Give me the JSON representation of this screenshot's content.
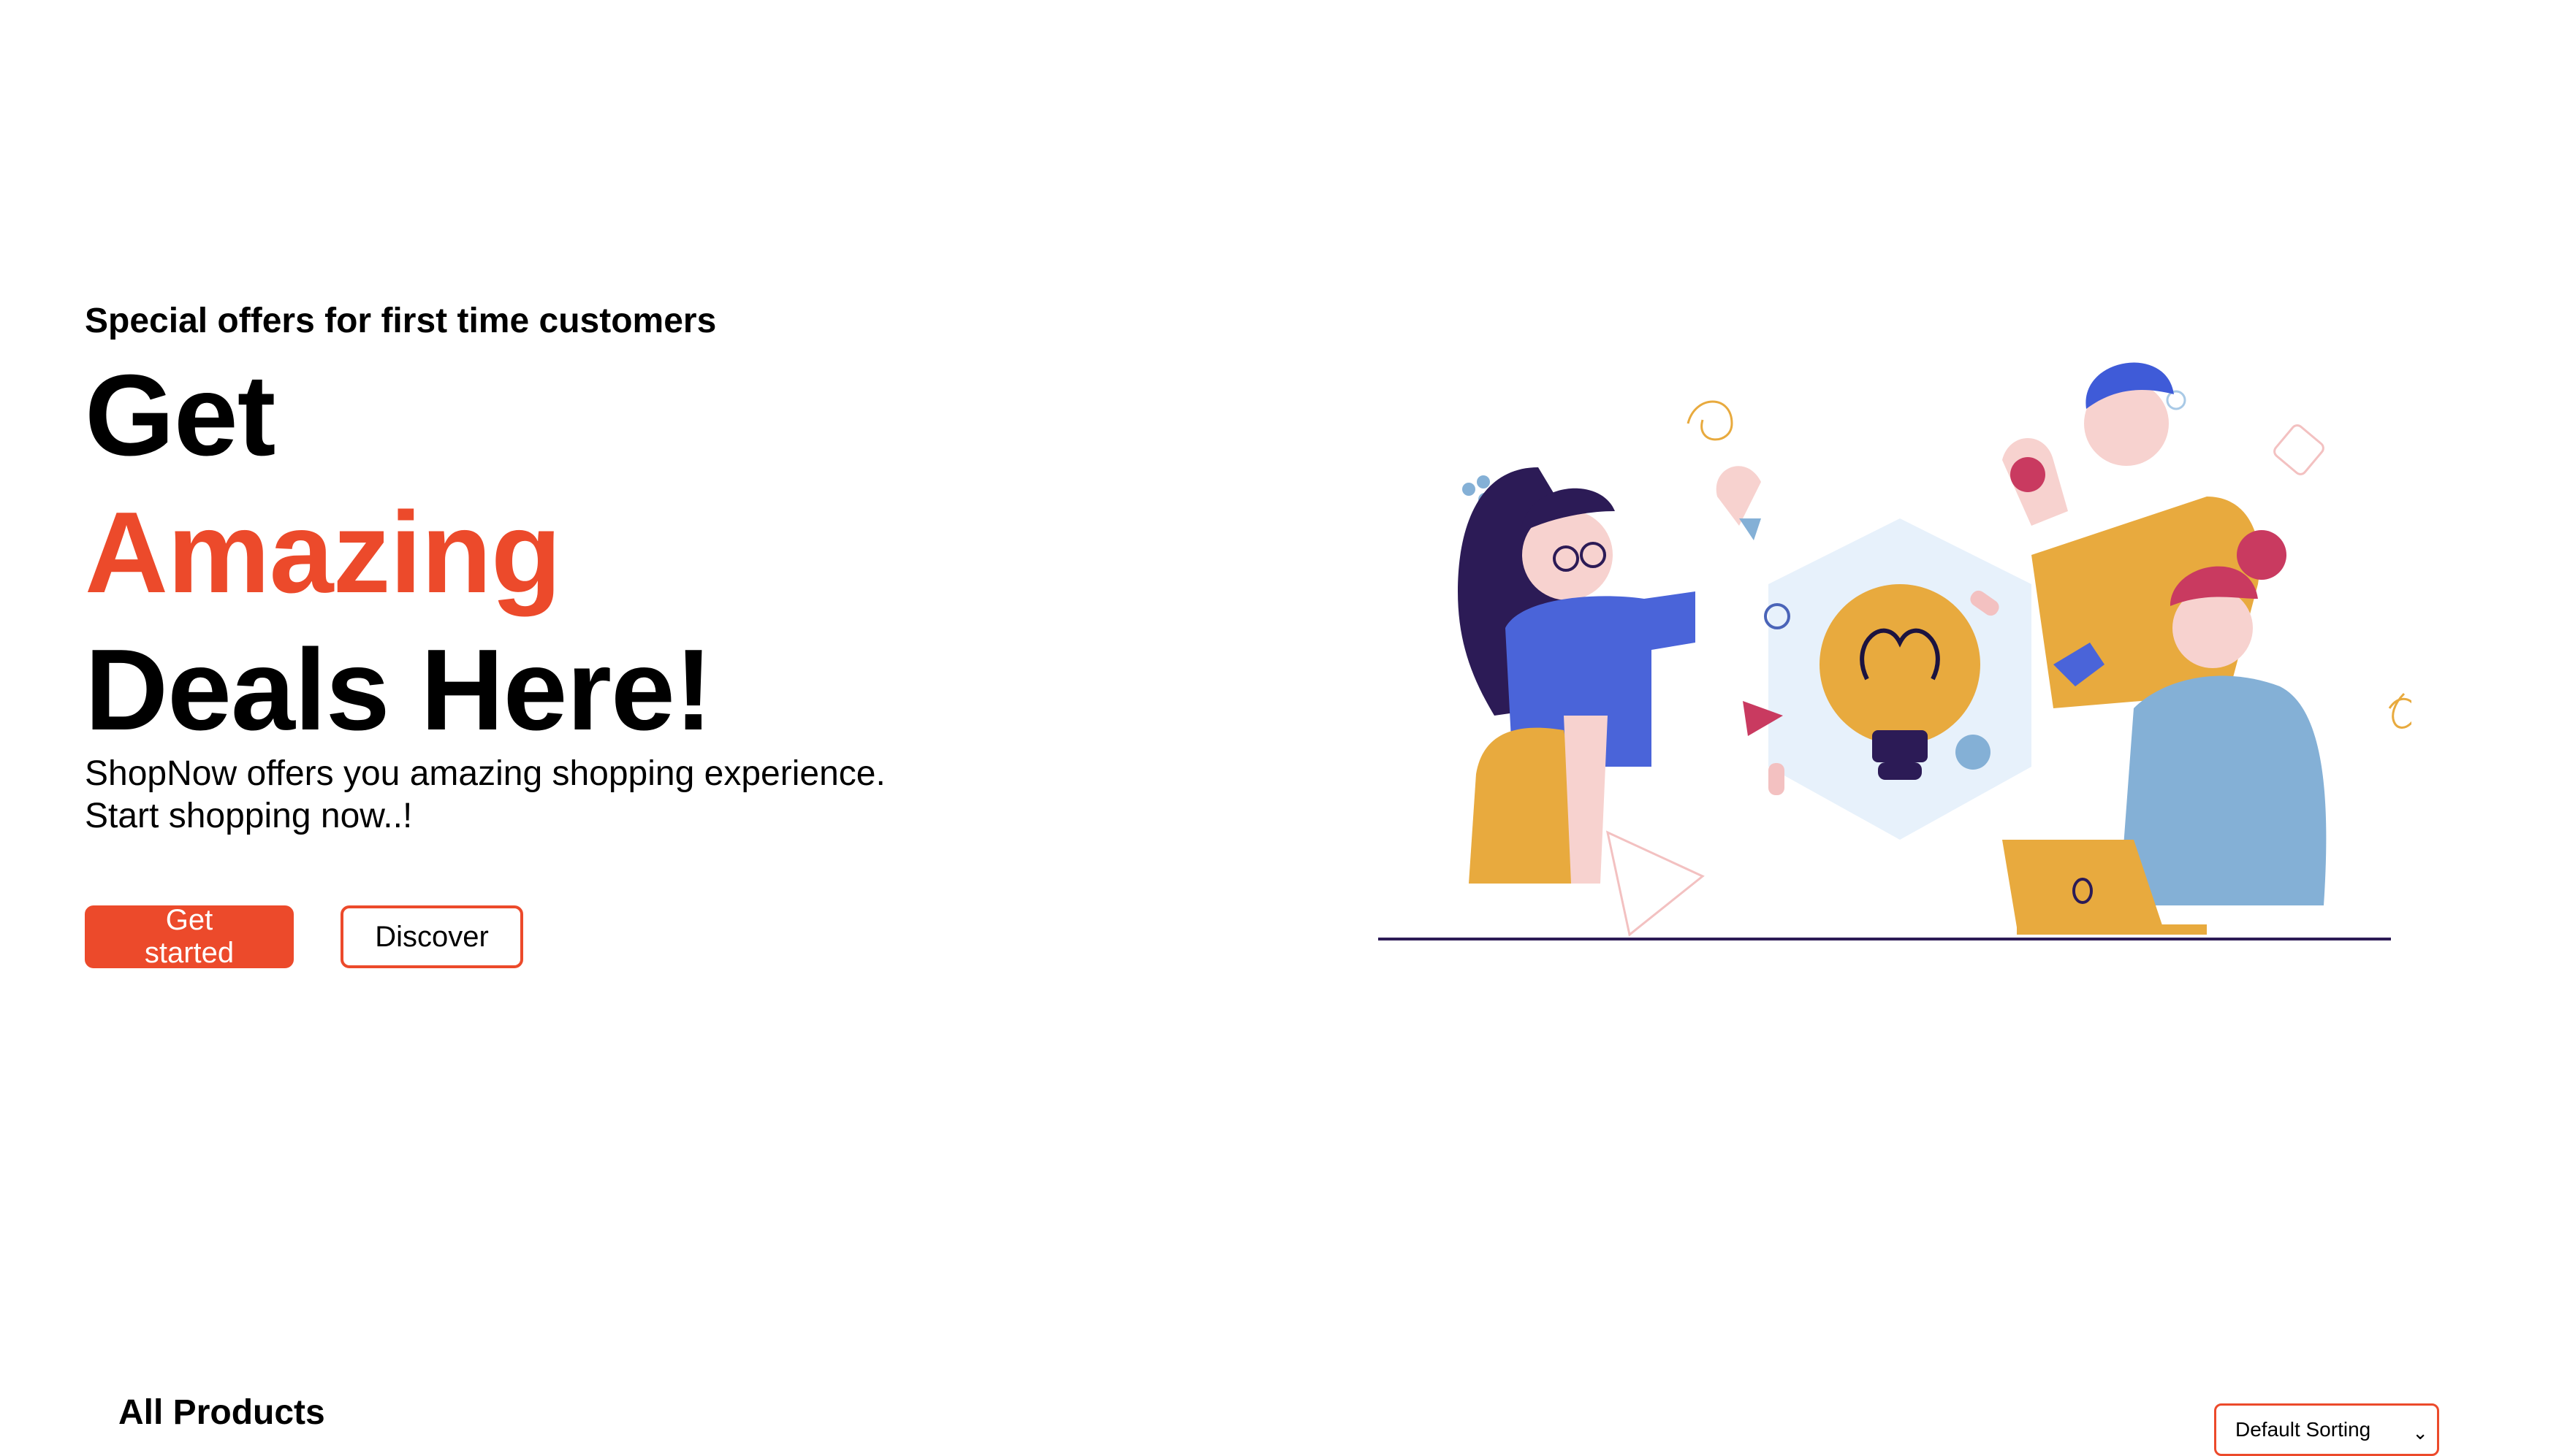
{
  "hero": {
    "kicker": "Special offers for first time customers",
    "headline_line1": "Get",
    "headline_line2": "Amazing",
    "headline_line3": "Deals Here!",
    "subtext": "ShopNow offers you amazing shopping experience. Start shopping now..!",
    "primary_button": "Get started",
    "secondary_button": "Discover",
    "illustration_icon": "team-idea-lightbulb-illustration"
  },
  "products": {
    "title": "All Products",
    "sort_selected": "Default Sorting"
  },
  "colors": {
    "accent": "#ec4a2b",
    "text": "#000000",
    "background": "#ffffff"
  }
}
